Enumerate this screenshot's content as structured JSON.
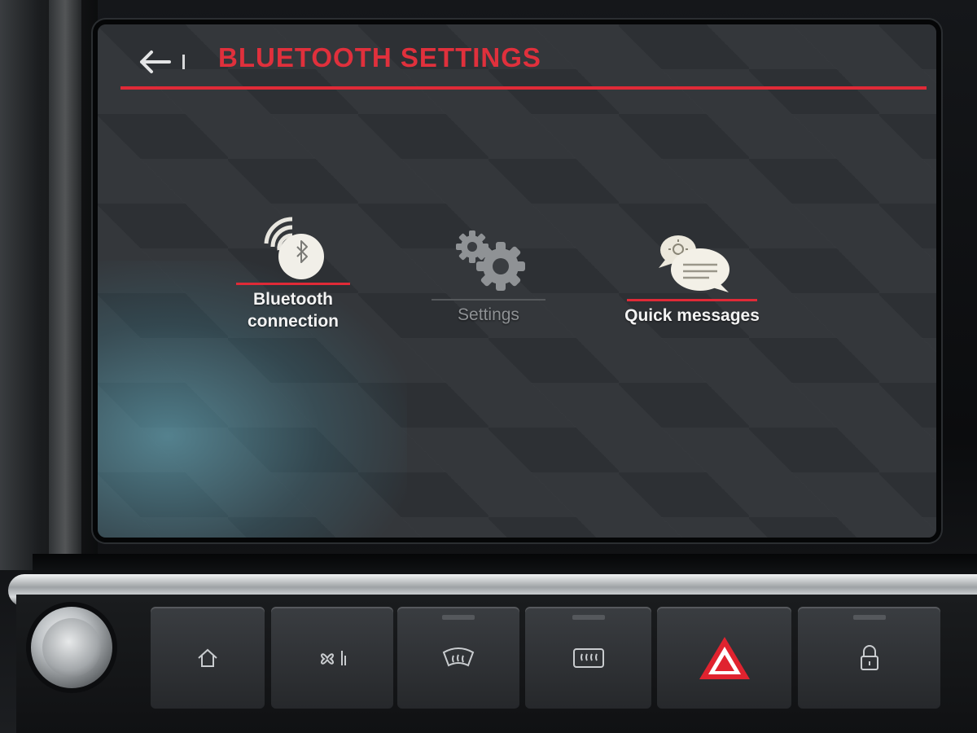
{
  "header": {
    "title": "BLUETOOTH SETTINGS"
  },
  "menu": {
    "bluetooth_connection": {
      "label": "Bluetooth\nconnection",
      "icon": "bluetooth-icon",
      "selected": true
    },
    "settings": {
      "label": "Settings",
      "icon": "gears-icon",
      "enabled": false
    },
    "quick_messages": {
      "label": "Quick messages",
      "icon": "chat-bubbles-icon",
      "selected": true
    }
  },
  "console_buttons": [
    {
      "icon": "home-icon"
    },
    {
      "icon": "fan-icon"
    },
    {
      "icon": "front-defrost-icon"
    },
    {
      "icon": "rear-defrost-icon"
    },
    {
      "icon": "hazard-icon"
    },
    {
      "icon": "lock-icon"
    }
  ],
  "colors": {
    "accent": "#e02a37",
    "text": "#f3f3f3",
    "disabled_text": "#8e9194"
  }
}
